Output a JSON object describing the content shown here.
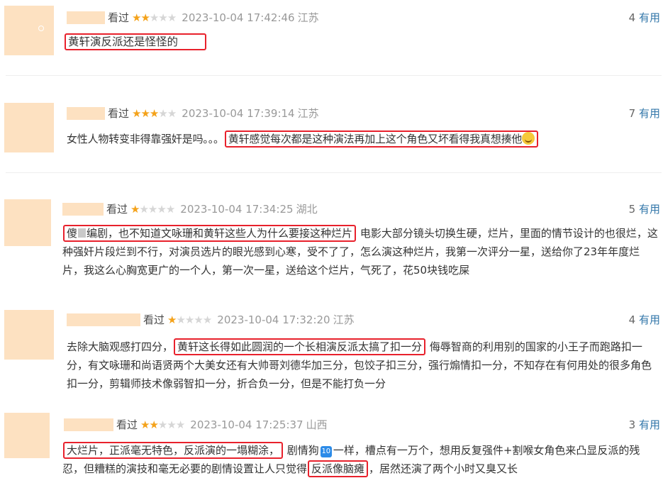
{
  "watched_label": "看过",
  "useful_label": "有用",
  "colors": {
    "star_on": "#f4a21a",
    "star_off": "#d6d6d6",
    "highlight_box": "#e8212c",
    "link_blue": "#3377aa",
    "placeholder": "#fde1c1"
  },
  "reviews": [
    {
      "rating": 2,
      "time": "2023-10-04 17:42:46",
      "location": "江苏",
      "useful_count": "4",
      "text_highlight": "黄轩演反派还是怪怪的"
    },
    {
      "rating": 3,
      "time": "2023-10-04 17:39:14",
      "location": "江苏",
      "useful_count": "7",
      "text_pre": "女性人物转变非得靠强奸是吗。。。",
      "text_highlight": "黄轩感觉每次都是这种演法再加上这个角色又坏看得我真想揍他",
      "emoji": "grinning-sweat-emoji"
    },
    {
      "rating": 1,
      "time": "2023-10-04 17:34:25",
      "location": "湖北",
      "useful_count": "5",
      "text_highlight_a": "傻",
      "text_highlight_b": "编剧，也不知道文咏珊和黄轩这些人为什么要接这种烂片",
      "text_rest": "电影大部分镜头切换生硬，烂片，里面的情节设计的也很烂，这种强奸片段烂到不行，对演员选片的眼光感到心寒，受不了了，怎么演这种烂片，我第一次评分一星，送给你了23年年度烂片，我这么心胸宽更广的一个人，第一次一星，送给这个烂片，气死了，花50块钱吃屎"
    },
    {
      "rating": 1,
      "time": "2023-10-04 17:32:20",
      "location": "江苏",
      "useful_count": "4",
      "text_pre": "去除大脑观感打四分，",
      "text_highlight": "黄轩这长得如此圆润的一个长相演反派太搞了扣一分",
      "text_rest": "侮辱智商的利用别的国家的小王子而跑路扣一分，有文咏珊和尚语贤两个大美女还有大帅哥刘德华加三分，包饺子扣三分，强行煽情扣一分，不知存在有何用处的很多角色扣一分，剪辑师技术像弱智扣一分，折合负一分，但是不能打负一分"
    },
    {
      "rating": 2,
      "time": "2023-10-04 17:25:37",
      "location": "山西",
      "useful_count": "3",
      "text_highlight": "大烂片，正派毫无特色，反派演的一塌糊涂，",
      "text_mid_a": "剧情狗",
      "badge": "10",
      "text_mid_b": "一样，槽点有一万个，想用反复强件+割喉女角色来凸显反派的残忍，但糟糕的演技和毫无必要的剧情设置让人只觉得",
      "text_highlight_2": "反派像脑瘫",
      "text_rest": "，居然还演了两个小时又臭又长"
    }
  ]
}
